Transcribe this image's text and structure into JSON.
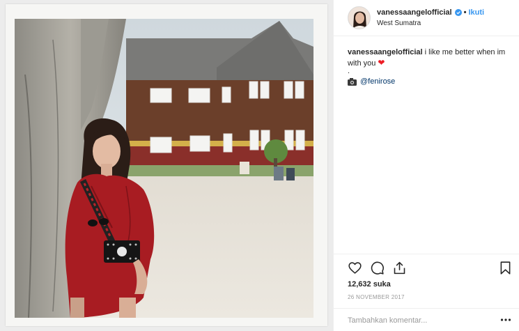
{
  "post": {
    "username": "vanessaangelofficial",
    "follow_label": "Ikuti",
    "dot_separator": "•",
    "location": "West Sumatra",
    "caption_user": "vanessaangelofficial",
    "caption_text": "i like me better when im with you",
    "caption_heart": "❤",
    "caption_dot": ".",
    "credit_mention": "@fenirose",
    "likes": "12,632 suka",
    "date": "26 NOVEMBER 2017",
    "comment_placeholder": "Tambahkan komentar..."
  },
  "colors": {
    "accent": "#3897f0",
    "mention": "#003569",
    "dress": "#a81c22",
    "heart": "#ed1c24"
  },
  "icons": [
    "verified-icon",
    "camera-icon",
    "heart-icon",
    "comment-icon",
    "share-icon",
    "bookmark-icon",
    "more-options-icon"
  ]
}
